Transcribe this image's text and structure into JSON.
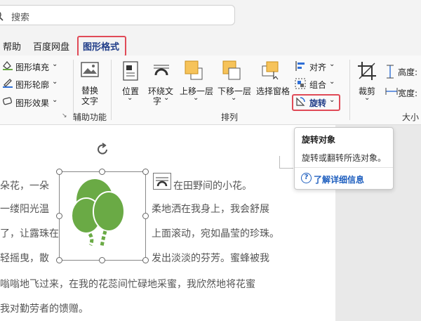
{
  "search": {
    "label": "搜索"
  },
  "tabs": {
    "help": "帮助",
    "baidu": "百度网盘",
    "active": "图形格式"
  },
  "ribbon": {
    "fill": "图形填充",
    "outline": "图形轮廓",
    "effects": "图形效果",
    "alt_text_1": "替换",
    "alt_text_2": "文字",
    "position": "位置",
    "wrap_1": "环绕文",
    "wrap_2": "字",
    "bring_forward": "上移一层",
    "send_backward": "下移一层",
    "selection_pane": "选择窗格",
    "align": "对齐",
    "group": "组合",
    "rotate": "旋转",
    "crop": "裁剪",
    "height": "高度:",
    "width": "宽度:",
    "group_accessibility": "辅助功能",
    "group_arrange": "排列",
    "group_size": "大小"
  },
  "tooltip": {
    "title": "旋转对象",
    "desc": "旋转或翻转所选对象。",
    "link": "了解详细信息"
  },
  "doc": {
    "l1a": "朵花，一朵",
    "l1b": "在田野间的小花。",
    "l2a": "一缕阳光温",
    "l2b": "柔地洒在我身上，我会舒展",
    "l3a": "了，让露珠在",
    "l3b": "上面滚动，宛如晶莹的珍珠。",
    "l4a": "轻摇曳，散",
    "l4b": "发出淡淡的芬芳。蜜蜂被我",
    "l5": "嗡嗡地飞过来，在我的花蕊间忙碌地采蜜，我欣然地将花蜜",
    "l6": "我对勤劳者的馈赠。"
  },
  "colors": {
    "accent": "#e04a57",
    "balloon": "#6aaa45",
    "link": "#1f5fbf"
  }
}
